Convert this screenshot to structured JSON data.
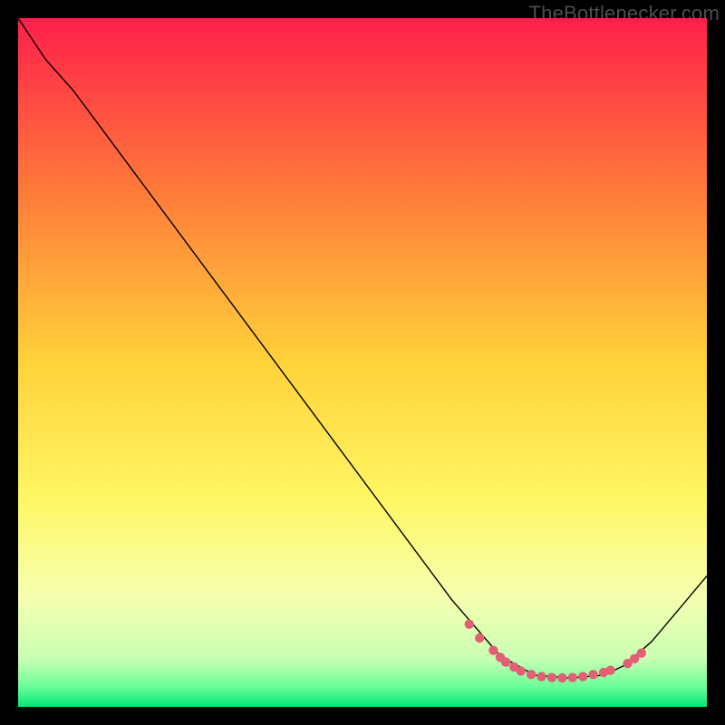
{
  "watermark": "TheBottlenecker.com",
  "chart_data": {
    "type": "line",
    "title": "",
    "xlabel": "",
    "ylabel": "",
    "xlim": [
      0,
      100
    ],
    "ylim": [
      0,
      100
    ],
    "background_gradient": {
      "stops": [
        {
          "pos": 0.0,
          "color": "#ff1f4b"
        },
        {
          "pos": 0.25,
          "color": "#ff7a3a"
        },
        {
          "pos": 0.5,
          "color": "#ffd23a"
        },
        {
          "pos": 0.7,
          "color": "#fff765"
        },
        {
          "pos": 0.84,
          "color": "#f6ffb0"
        },
        {
          "pos": 0.93,
          "color": "#c9ffb3"
        },
        {
          "pos": 0.97,
          "color": "#6dff9a"
        },
        {
          "pos": 1.0,
          "color": "#00e676"
        }
      ]
    },
    "series": [
      {
        "name": "curve",
        "stroke": "#000000",
        "stroke_width": 1.4,
        "points": [
          {
            "x": 0.0,
            "y": 100.0
          },
          {
            "x": 4.0,
            "y": 94.0
          },
          {
            "x": 8.0,
            "y": 89.5
          },
          {
            "x": 63.0,
            "y": 15.5
          },
          {
            "x": 70.0,
            "y": 7.4
          },
          {
            "x": 75.0,
            "y": 4.6
          },
          {
            "x": 80.0,
            "y": 4.2
          },
          {
            "x": 85.0,
            "y": 4.6
          },
          {
            "x": 88.0,
            "y": 6.0
          },
          {
            "x": 92.0,
            "y": 9.5
          },
          {
            "x": 100.0,
            "y": 19.0
          }
        ]
      },
      {
        "name": "optimal-band-markers",
        "stroke": "none",
        "marker_fill": "#e35f73",
        "marker_r": 5.2,
        "points": [
          {
            "x": 65.5,
            "y": 12.0
          },
          {
            "x": 67.0,
            "y": 10.0
          },
          {
            "x": 69.0,
            "y": 8.2
          },
          {
            "x": 70.0,
            "y": 7.2
          },
          {
            "x": 70.8,
            "y": 6.5
          },
          {
            "x": 72.0,
            "y": 5.8
          },
          {
            "x": 73.0,
            "y": 5.2
          },
          {
            "x": 74.5,
            "y": 4.7
          },
          {
            "x": 76.0,
            "y": 4.4
          },
          {
            "x": 77.5,
            "y": 4.25
          },
          {
            "x": 79.0,
            "y": 4.2
          },
          {
            "x": 80.5,
            "y": 4.25
          },
          {
            "x": 82.0,
            "y": 4.4
          },
          {
            "x": 83.5,
            "y": 4.7
          },
          {
            "x": 85.0,
            "y": 5.0
          },
          {
            "x": 86.0,
            "y": 5.3
          },
          {
            "x": 88.5,
            "y": 6.3
          },
          {
            "x": 89.5,
            "y": 7.0
          },
          {
            "x": 90.5,
            "y": 7.8
          }
        ]
      }
    ]
  }
}
